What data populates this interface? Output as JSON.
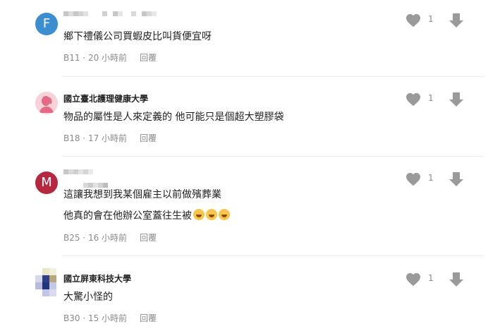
{
  "comments": [
    {
      "avatar_letter": "F",
      "avatar_color": "#3b8ed0",
      "school": "",
      "text_lines": [
        "鄉下禮儀公司買蝦皮比叫貨便宜呀"
      ],
      "floor": "B11",
      "time": "20 小時前",
      "reply": "回覆",
      "likes": "1"
    },
    {
      "avatar_letter": "",
      "avatar_color": "#f7d3d8",
      "school": "國立臺北護理健康大學",
      "text_lines": [
        "物品的屬性是人來定義的 他可能只是個超大塑膠袋"
      ],
      "floor": "B18",
      "time": "17 小時前",
      "reply": "回覆",
      "likes": "1"
    },
    {
      "avatar_letter": "M",
      "avatar_color": "#b5283f",
      "school": "",
      "text_lines": [
        "這讓我想到我某個雇主以前做殯葬業",
        "他真的會在他辦公室蓋往生被"
      ],
      "floor": "B25",
      "time": "16 小時前",
      "reply": "回覆",
      "likes": "1"
    },
    {
      "avatar_letter": "",
      "avatar_color": "#c7cbe8",
      "school": "國立屏東科技大學",
      "text_lines": [
        "大驚小怪的"
      ],
      "floor": "B30",
      "time": "15 小時前",
      "reply": "回覆",
      "likes": "1"
    }
  ],
  "icons": {
    "like": "heart-icon",
    "dislike": "down-arrow-icon",
    "emoji": "laughing-crying-emoji"
  },
  "colors": {
    "icon_gray": "#9a9a9a",
    "meta_gray": "#8a8a8a",
    "divider": "#eeeeee"
  }
}
